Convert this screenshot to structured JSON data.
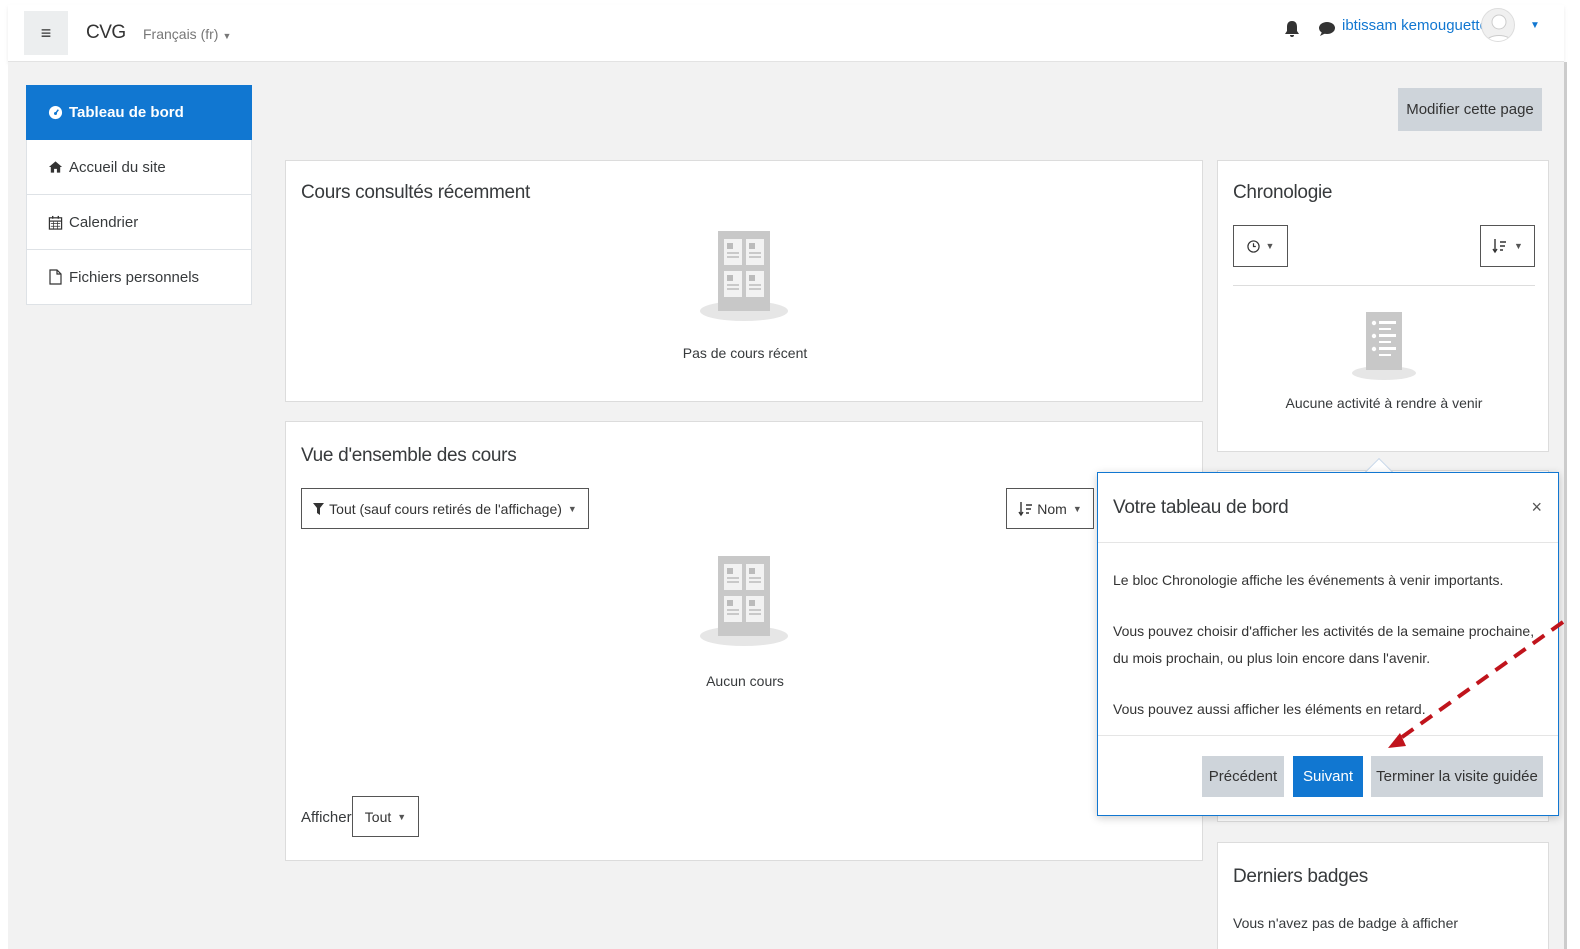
{
  "navbar": {
    "brand": "CVG",
    "language": "Français (fr)",
    "user_name": "ibtissam kemouguette"
  },
  "sidebar": {
    "items": [
      {
        "label": "Tableau de bord",
        "icon": "dashboard-icon",
        "active": true
      },
      {
        "label": "Accueil du site",
        "icon": "home-icon",
        "active": false
      },
      {
        "label": "Calendrier",
        "icon": "calendar-icon",
        "active": false
      },
      {
        "label": "Fichiers personnels",
        "icon": "file-icon",
        "active": false
      }
    ]
  },
  "header": {
    "edit_button": "Modifier cette page"
  },
  "recent_courses": {
    "title": "Cours consultés récemment",
    "empty_text": "Pas de cours récent"
  },
  "course_overview": {
    "title": "Vue d'ensemble des cours",
    "filter_label": "Tout (sauf cours retirés de l'affichage)",
    "sort_label": "Nom",
    "empty_text": "Aucun cours",
    "show_label": "Afficher",
    "show_value": "Tout"
  },
  "timeline": {
    "title": "Chronologie",
    "empty_text": "Aucune activité à rendre à venir"
  },
  "badges": {
    "title": "Derniers badges",
    "empty_text": "Vous n'avez pas de badge à afficher"
  },
  "tour": {
    "title": "Votre tableau de bord",
    "close": "×",
    "paragraphs": [
      "Le bloc Chronologie affiche les événements à venir importants.",
      "Vous pouvez choisir d'afficher les activités de la semaine prochaine, du mois prochain, ou plus loin encore dans l'avenir.",
      "Vous pouvez aussi afficher les éléments en retard."
    ],
    "prev_button": "Précédent",
    "next_button": "Suivant",
    "end_button": "Terminer la visite guidée"
  },
  "colors": {
    "accent": "#1177d1",
    "annotation_arrow": "#c0141c"
  }
}
